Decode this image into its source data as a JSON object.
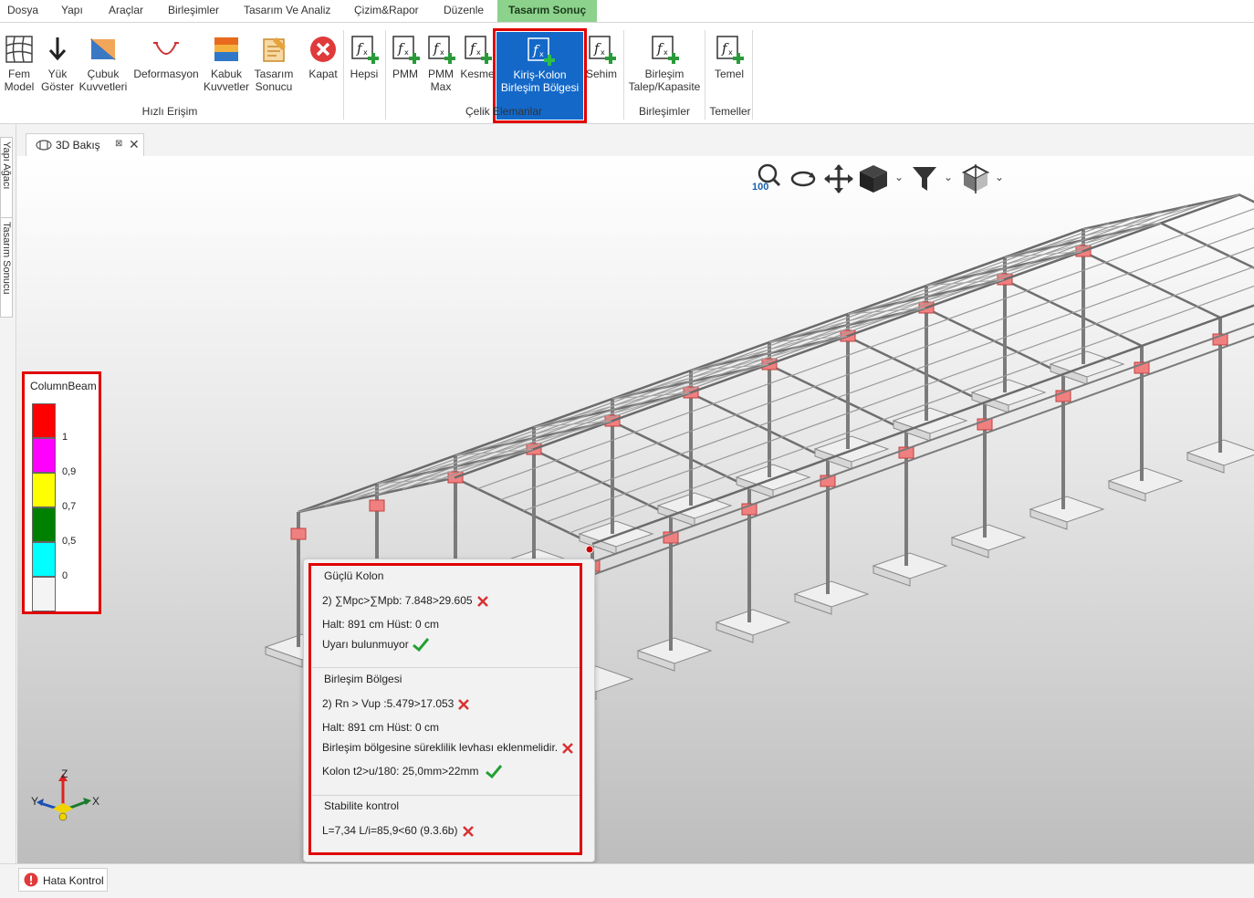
{
  "menu": {
    "items": [
      {
        "label": "Dosya"
      },
      {
        "label": "Yapı"
      },
      {
        "label": "Araçlar"
      },
      {
        "label": "Birleşimler"
      },
      {
        "label": "Tasarım Ve Analiz"
      },
      {
        "label": "Çizim&Rapor"
      },
      {
        "label": "Düzenle"
      },
      {
        "label": "Tasarım Sonuç"
      }
    ]
  },
  "ribbon": {
    "fem_model": "Fem\nModel",
    "yuk_goster": "Yük\nGöster",
    "cubuk": "Çubuk\nKuvvetleri",
    "deformasyon": "Deformasyon",
    "kabuk": "Kabuk\nKuvvetler",
    "tasarim_sonucu": "Tasarım\nSonucu",
    "kapat": "Kapat",
    "hepsi": "Hepsi",
    "pmm": "PMM",
    "pmm_max": "PMM\nMax",
    "kesme": "Kesme",
    "kiris_kolon": "Kiriş-Kolon\nBirleşim Bölgesi",
    "sehim": "Sehim",
    "birlesim_talep": "Birleşim\nTalep/Kapasite",
    "temel": "Temel",
    "group_hizli": "Hızlı Erişim",
    "group_celik": "Çelik Elemanlar",
    "group_birlesimler": "Birleşimler",
    "group_temeller": "Temeller"
  },
  "side_tabs": {
    "yapi_agaci": "Yapı Ağacı",
    "tasarim_sonucu": "Tasarım Sonucu"
  },
  "doc_tab": {
    "label": "3D Bakış"
  },
  "view_toolbar": {
    "zoom_level": "100"
  },
  "legend": {
    "title": "ColumnBeam",
    "colors": [
      "#ff0000",
      "#ff00ff",
      "#ffff00",
      "#008000",
      "#00ffff",
      "#f4f4f4"
    ],
    "values": [
      "1",
      "0,9",
      "0,7",
      "0,5",
      "0"
    ]
  },
  "popup": {
    "guclu_kolon": "Güçlü Kolon",
    "gk_line1": "2) ∑Mpc>∑Mpb: 7.848>29.605",
    "gk_line2": "Halt: 891 cm Hüst: 0 cm",
    "gk_line3": "Uyarı bulunmuyor",
    "birlesim_bolgesi": "Birleşim Bölgesi",
    "bb_line1": "2) Rn > Vup :5.479>17.053",
    "bb_line2": "Halt: 891 cm Hüst: 0 cm",
    "bb_line3": "Birleşim bölgesine süreklilik levhası eklenmelidir.",
    "bb_line4": "Kolon t2>u/180: 25,0mm>22mm",
    "stabilite": "Stabilite kontrol",
    "st_line1": "L=7,34 L/i=85,9<60 (9.3.6b)"
  },
  "axes": {
    "z": "Z",
    "y": "Y",
    "x": "X"
  },
  "status": {
    "hata_kontrol": "Hata Kontrol"
  }
}
